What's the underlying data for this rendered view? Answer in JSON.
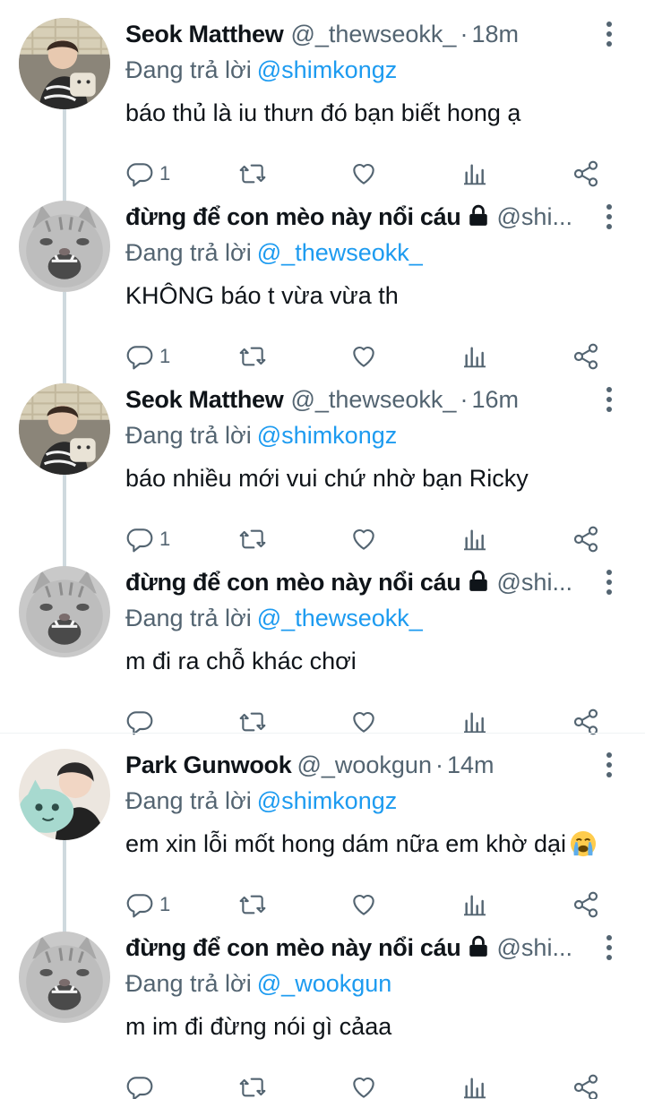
{
  "tweets": [
    {
      "name": "Seok Matthew",
      "handle": "@_thewseokk_",
      "time": "18m",
      "replying_prefix": "Đang trả lời",
      "replying_to": "@shimkongz",
      "text": "báo thủ là iu thưn đó bạn biết hong ạ",
      "reply_count": "1",
      "avatar": "photo-person-sweater"
    },
    {
      "name": "đừng để con mèo này nổi cáu",
      "handle": "@shi...",
      "time": "",
      "replying_prefix": "Đang trả lời",
      "replying_to": "@_thewseokk_",
      "text": "KHÔNG báo t vừa vừa th",
      "reply_count": "1",
      "avatar": "photo-cat"
    },
    {
      "name": "Seok Matthew",
      "handle": "@_thewseokk_",
      "time": "16m",
      "replying_prefix": "Đang trả lời",
      "replying_to": "@shimkongz",
      "text": "báo nhiều mới vui chứ nhờ bạn Ricky",
      "reply_count": "1",
      "avatar": "photo-person-sweater"
    },
    {
      "name": "đừng để con mèo này nổi cáu",
      "handle": "@shi...",
      "time": "",
      "replying_prefix": "Đang trả lời",
      "replying_to": "@_thewseokk_",
      "text": "m đi ra chỗ khác chơi",
      "reply_count": "",
      "avatar": "photo-cat"
    },
    {
      "name": "Park Gunwook",
      "handle": "@_wookgun",
      "time": "14m",
      "replying_prefix": "Đang trả lời",
      "replying_to": "@shimkongz",
      "text": "em xin lỗi mốt hong dám nữa em khờ dại",
      "reply_count": "1",
      "avatar": "photo-person-plush"
    },
    {
      "name": "đừng để con mèo này nổi cáu",
      "handle": "@shi...",
      "time": "",
      "replying_prefix": "Đang trả lời",
      "replying_to": "@_wookgun",
      "text": "m im đi đừng nói gì cảaa",
      "reply_count": "",
      "avatar": "photo-cat"
    }
  ],
  "colors": {
    "accent": "#1d9bf0",
    "secondary_text": "#536471",
    "thread_line": "#cfd9de"
  },
  "icons": {
    "reply": "comment-icon",
    "retweet": "retweet-icon",
    "like": "heart-icon",
    "stats": "views-icon",
    "share": "share-icon",
    "more": "more-vertical-icon",
    "lock": "lock-icon",
    "emoji": "loudly-crying-face-emoji"
  }
}
